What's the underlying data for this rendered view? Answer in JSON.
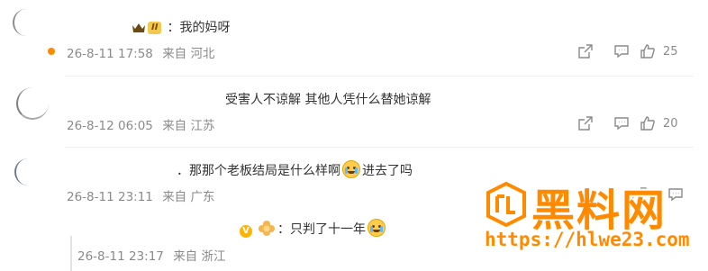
{
  "comments": [
    {
      "content": "：我的妈呀",
      "level_badge": "II",
      "date": "26-8-11 17:58",
      "location": "来自 河北",
      "likes": "25"
    },
    {
      "content": "受害人不谅解 其他人凭什么替她谅解",
      "date": "26-8-12 06:05",
      "location": "来自 江苏",
      "likes": "20"
    },
    {
      "content_before": "．那那个老板结局是什么样啊",
      "content_after": "进去了吗",
      "date": "26-8-11 23:11",
      "location": "来自 广东"
    }
  ],
  "reply": {
    "content": "：只判了十一年",
    "date": "26-8-11 23:17",
    "location": "来自 浙江"
  },
  "watermark": {
    "title": "黑料网",
    "url": "https://hlwe23.com"
  },
  "icons": {
    "share": "share-icon",
    "comment": "comment-icon",
    "like": "like-icon"
  },
  "colors": {
    "meta_text": "#8a8a8a",
    "watermark": "#ff8a00",
    "level_badge": "#f2c94c"
  }
}
